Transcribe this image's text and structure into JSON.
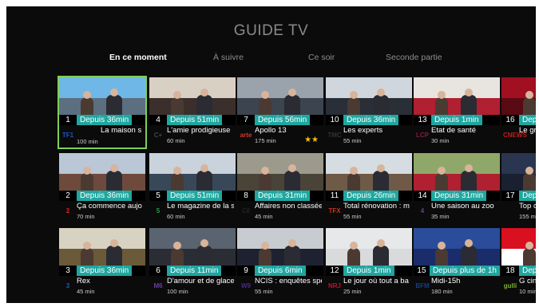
{
  "title": "GUIDE TV",
  "tabs": [
    {
      "label": "En ce moment",
      "active": true
    },
    {
      "label": "À suivre",
      "active": false
    },
    {
      "label": "Ce soir",
      "active": false
    },
    {
      "label": "Seconde partie",
      "active": false
    }
  ],
  "accent_color": "#1fa6a0",
  "selection_color": "#7fcf5a",
  "rows": [
    [
      {
        "channel": "1",
        "since": "Depuis 36min",
        "logo": "TF1",
        "logo_color": "#1f55c8",
        "program": "La maison s",
        "duration": "100 min",
        "stars": "",
        "selected": true,
        "sky": "#6fb7e6",
        "ground": "#5b6f80"
      },
      {
        "channel": "4",
        "since": "Depuis 51min",
        "logo": "C+",
        "logo_color": "#444",
        "program": "L'amie prodigieuse",
        "duration": "60 min",
        "stars": "",
        "sky": "#d9d0c4",
        "ground": "#3a2f2a"
      },
      {
        "channel": "7",
        "since": "Depuis 56min",
        "logo": "arte",
        "logo_color": "#d03a2a",
        "program": "Apollo 13",
        "duration": "175 min",
        "stars": "★★",
        "sky": "#9aa2ab",
        "ground": "#3c4450"
      },
      {
        "channel": "10",
        "since": "Depuis 36min",
        "logo": "TMC",
        "logo_color": "#333",
        "program": "Les experts",
        "duration": "55 min",
        "stars": "",
        "sky": "#cfd6de",
        "ground": "#2a2e36"
      },
      {
        "channel": "13",
        "since": "Depuis 1min",
        "logo": "LCP",
        "logo_color": "#8a1c3a",
        "program": "Etat de santé",
        "duration": "30 min",
        "stars": "",
        "sky": "#e8e4e0",
        "ground": "#b02030"
      },
      {
        "channel": "16",
        "since": "Depuis",
        "logo": "CNEWS",
        "logo_color": "#c41a1a",
        "program": "Le gr",
        "duration": "",
        "stars": "",
        "sky": "#a01020",
        "ground": "#5a0a12"
      }
    ],
    [
      {
        "channel": "2",
        "since": "Depuis 36min",
        "logo": "2",
        "logo_color": "#d22",
        "program": "Ça commence aujo",
        "duration": "70 min",
        "stars": "",
        "sky": "#b9c7d6",
        "ground": "#6d4a3c"
      },
      {
        "channel": "5",
        "since": "Depuis 51min",
        "logo": "5",
        "logo_color": "#2a9d4a",
        "program": "Le magazine de la s",
        "duration": "60 min",
        "stars": "",
        "sky": "#cad3dc",
        "ground": "#384858"
      },
      {
        "channel": "8",
        "since": "Depuis 31min",
        "logo": "C8",
        "logo_color": "#222",
        "program": "Affaires non classée",
        "duration": "45 min",
        "stars": "",
        "sky": "#9c9a8c",
        "ground": "#4a4438"
      },
      {
        "channel": "11",
        "since": "Depuis 26min",
        "logo": "TFX",
        "logo_color": "#d03020",
        "program": "Total rénovation : m",
        "duration": "55 min",
        "stars": "",
        "sky": "#d6dde2",
        "ground": "#6e5a46"
      },
      {
        "channel": "14",
        "since": "Depuis 31min",
        "logo": "4",
        "logo_color": "#6a3ca0",
        "program": "Une saison au zoo",
        "duration": "35 min",
        "stars": "",
        "sky": "#8fa86a",
        "ground": "#b02030"
      },
      {
        "channel": "17",
        "since": "Depuis",
        "logo": "",
        "logo_color": "#000",
        "program": "Top c",
        "duration": "155 mi",
        "stars": "",
        "sky": "#2a3550",
        "ground": "#1a2030"
      }
    ],
    [
      {
        "channel": "3",
        "since": "Depuis 36min",
        "logo": "3",
        "logo_color": "#1c5cb0",
        "program": "Rex",
        "duration": "45 min",
        "stars": "",
        "sky": "#d8d2c2",
        "ground": "#6a5a3a"
      },
      {
        "channel": "6",
        "since": "Depuis 11min",
        "logo": "M6",
        "logo_color": "#6b3ca8",
        "program": "D'amour et de glace",
        "duration": "100 min",
        "stars": "",
        "sky": "#5a6470",
        "ground": "#2a2e34"
      },
      {
        "channel": "9",
        "since": "Depuis 6min",
        "logo": "W9",
        "logo_color": "#4a2a8a",
        "program": "NCIS : enquêtes spé",
        "duration": "55 min",
        "stars": "",
        "sky": "#c8ccd0",
        "ground": "#1e2230"
      },
      {
        "channel": "12",
        "since": "Depuis 1min",
        "logo": "NRJ",
        "logo_color": "#c01030",
        "program": "Le jour où tout a ba",
        "duration": "25 min",
        "stars": "",
        "sky": "#e6e8ea",
        "ground": "#d8dadc"
      },
      {
        "channel": "15",
        "since": "Depuis plus de 1h",
        "logo": "BFM",
        "logo_color": "#1a3c8a",
        "program": "Midi-15h",
        "duration": "180 min",
        "stars": "",
        "sky": "#2a4c9a",
        "ground": "#1a2c6a",
        "thumb_text": "MIDI 15H"
      },
      {
        "channel": "18",
        "since": "Depuis",
        "logo": "gulli",
        "logo_color": "#7ab030",
        "program": "G ciné",
        "duration": "10 min",
        "stars": "",
        "sky": "#d81020",
        "ground": "#ffffff"
      }
    ]
  ]
}
